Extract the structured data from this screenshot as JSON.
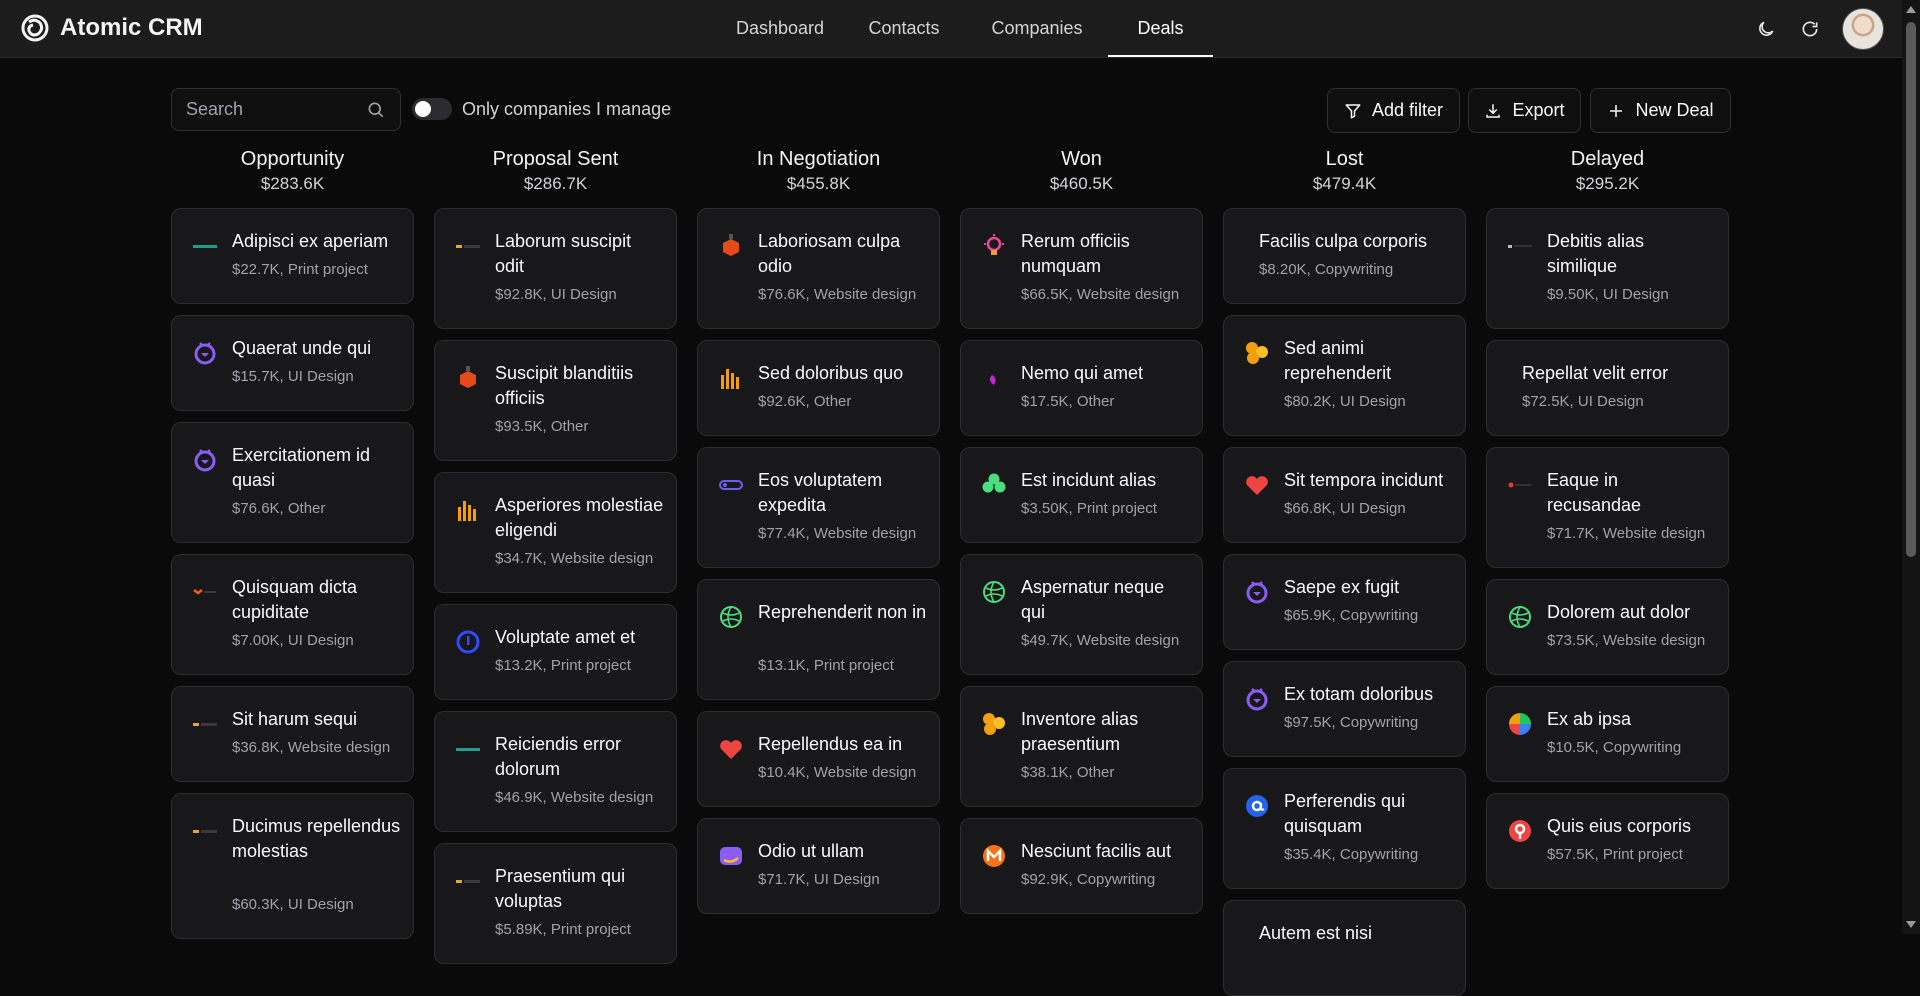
{
  "app": {
    "title": "Atomic CRM"
  },
  "nav": {
    "tabs": [
      "Dashboard",
      "Contacts",
      "Companies",
      "Deals"
    ],
    "active": "Deals"
  },
  "toolbar": {
    "search_placeholder": "Search",
    "toggle_label": "Only companies I manage",
    "add_filter": "Add filter",
    "export": "Export",
    "new_deal": "New Deal"
  },
  "columns": [
    {
      "title": "Opportunity",
      "total": "$283.6K",
      "cards": [
        {
          "title": "Adipisci ex aperiam",
          "sub": "$22.7K, Print project",
          "logo": "dash-logo-teal"
        },
        {
          "title": "Quaerat unde qui",
          "sub": "$15.7K, UI Design",
          "logo": "timer-logo-purple"
        },
        {
          "title": "Exercitationem id quasi",
          "sub": "$76.6K, Other",
          "logo": "timer-logo-purple"
        },
        {
          "title": "Quisquam dicta cupiditate",
          "sub": "$7.00K, UI Design",
          "logo": "dash-logo-orange"
        },
        {
          "title": "Sit harum sequi",
          "sub": "$36.8K, Website design",
          "logo": "dash-logo-amber"
        },
        {
          "title": "Ducimus repellendus molestias",
          "sub": "$60.3K, UI Design",
          "logo": "dash-logo-amber"
        }
      ]
    },
    {
      "title": "Proposal Sent",
      "total": "$286.7K",
      "cards": [
        {
          "title": "Laborum suscipit odit",
          "sub": "$92.8K, UI Design",
          "logo": "dash-logo-amber"
        },
        {
          "title": "Suscipit blanditiis officiis",
          "sub": "$93.5K, Other",
          "logo": "hex-logo-red"
        },
        {
          "title": "Asperiores molestiae eligendi",
          "sub": "$34.7K, Website design",
          "logo": "bars-logo-orange"
        },
        {
          "title": "Voluptate amet et",
          "sub": "$13.2K, Print project",
          "logo": "ring-logo-blue"
        },
        {
          "title": "Reiciendis error dolorum",
          "sub": "$46.9K, Website design",
          "logo": "dash-logo-teal"
        },
        {
          "title": "Praesentium qui voluptas",
          "sub": "$5.89K, Print project",
          "logo": "dash-logo-amber"
        }
      ]
    },
    {
      "title": "In Negotiation",
      "total": "$455.8K",
      "cards": [
        {
          "title": "Laboriosam culpa odio",
          "sub": "$76.6K, Website design",
          "logo": "hex-logo-red"
        },
        {
          "title": "Sed doloribus quo",
          "sub": "$92.6K, Other",
          "logo": "bars-logo-orange"
        },
        {
          "title": "Eos voluptatem expedita",
          "sub": "$77.4K, Website design",
          "logo": "pill-logo-violet"
        },
        {
          "title": "Reprehenderit non in",
          "sub": "$13.1K, Print project",
          "logo": "globe-logo-green"
        },
        {
          "title": "Repellendus ea in",
          "sub": "$10.4K, Website design",
          "logo": "heart-logo-red"
        },
        {
          "title": "Odio ut ullam",
          "sub": "$71.7K, UI Design",
          "logo": "square-logo-purple"
        }
      ]
    },
    {
      "title": "Won",
      "total": "$460.5K",
      "cards": [
        {
          "title": "Rerum officiis numquam",
          "sub": "$66.5K, Website design",
          "logo": "bulb-logo-pink"
        },
        {
          "title": "Nemo qui amet",
          "sub": "$17.5K, Other",
          "logo": "leaf-logo-magenta"
        },
        {
          "title": "Est incidunt alias",
          "sub": "$3.50K, Print project",
          "logo": "clover-logo-green"
        },
        {
          "title": "Aspernatur neque qui",
          "sub": "$49.7K, Website design",
          "logo": "globe-logo-green"
        },
        {
          "title": "Inventore alias praesentium",
          "sub": "$38.1K, Other",
          "logo": "blob-logo-orange"
        },
        {
          "title": "Nesciunt facilis aut",
          "sub": "$92.9K, Copywriting",
          "logo": "m-logo-orange"
        }
      ]
    },
    {
      "title": "Lost",
      "total": "$479.4K",
      "cards": [
        {
          "title": "Facilis culpa corporis",
          "sub": "$8.20K, Copywriting",
          "logo": ""
        },
        {
          "title": "Sed animi reprehenderit",
          "sub": "$80.2K, UI Design",
          "logo": "blob-logo-orange"
        },
        {
          "title": "Sit tempora incidunt",
          "sub": "$66.8K, UI Design",
          "logo": "heart-logo-red"
        },
        {
          "title": "Saepe ex fugit",
          "sub": "$65.9K, Copywriting",
          "logo": "timer-logo-purple"
        },
        {
          "title": "Ex totam doloribus",
          "sub": "$97.5K, Copywriting",
          "logo": "timer-logo-purple"
        },
        {
          "title": "Perferendis qui quisquam",
          "sub": "$35.4K, Copywriting",
          "logo": "at-logo-blue"
        },
        {
          "title": "Autem est nisi",
          "sub": "",
          "logo": ""
        }
      ]
    },
    {
      "title": "Delayed",
      "total": "$295.2K",
      "cards": [
        {
          "title": "Debitis alias similique",
          "sub": "$9.50K, UI Design",
          "logo": "dash-logo-gray"
        },
        {
          "title": "Repellat velit error",
          "sub": "$72.5K, UI Design",
          "logo": ""
        },
        {
          "title": "Eaque in recusandae",
          "sub": "$71.7K, Website design",
          "logo": "dash-logo-red"
        },
        {
          "title": "Dolorem aut dolor",
          "sub": "$73.5K, Website design",
          "logo": "globe-logo-green"
        },
        {
          "title": "Ex ab ipsa",
          "sub": "$10.5K, Copywriting",
          "logo": "pie-logo-multi"
        },
        {
          "title": "Quis eius corporis",
          "sub": "$57.5K, Print project",
          "logo": "pin-logo-red"
        }
      ]
    }
  ]
}
